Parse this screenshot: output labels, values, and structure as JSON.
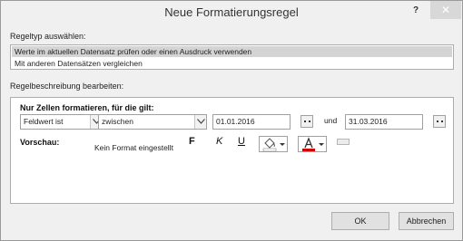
{
  "window": {
    "title": "Neue Formatierungsregel",
    "help_label": "?",
    "close_label": "✕"
  },
  "rule_type": {
    "label": "Regeltyp auswählen:",
    "items": [
      {
        "label": "Werte im aktuellen Datensatz prüfen oder einen Ausdruck verwenden",
        "selected": true
      },
      {
        "label": "Mit anderen Datensätzen vergleichen",
        "selected": false
      }
    ]
  },
  "rule_description": {
    "label": "Regelbeschreibung bearbeiten:",
    "condition_heading": "Nur Zellen formatieren, für die gilt:",
    "field_select": "Feldwert ist",
    "operator_select": "zwischen",
    "value1": "01.01.2016",
    "and_label": "und",
    "value2": "31.03.2016",
    "preview_label": "Vorschau:",
    "preview_text": "Kein Format eingestellt",
    "bold_label": "F",
    "italic_label": "K",
    "underline_label": "U",
    "fill_color_icon": "paint-bucket-icon",
    "font_color_icon": "font-color-icon",
    "font_color": "#cc0000",
    "fill_color": "#ffffff"
  },
  "buttons": {
    "ok": "OK",
    "cancel": "Abbrechen"
  }
}
